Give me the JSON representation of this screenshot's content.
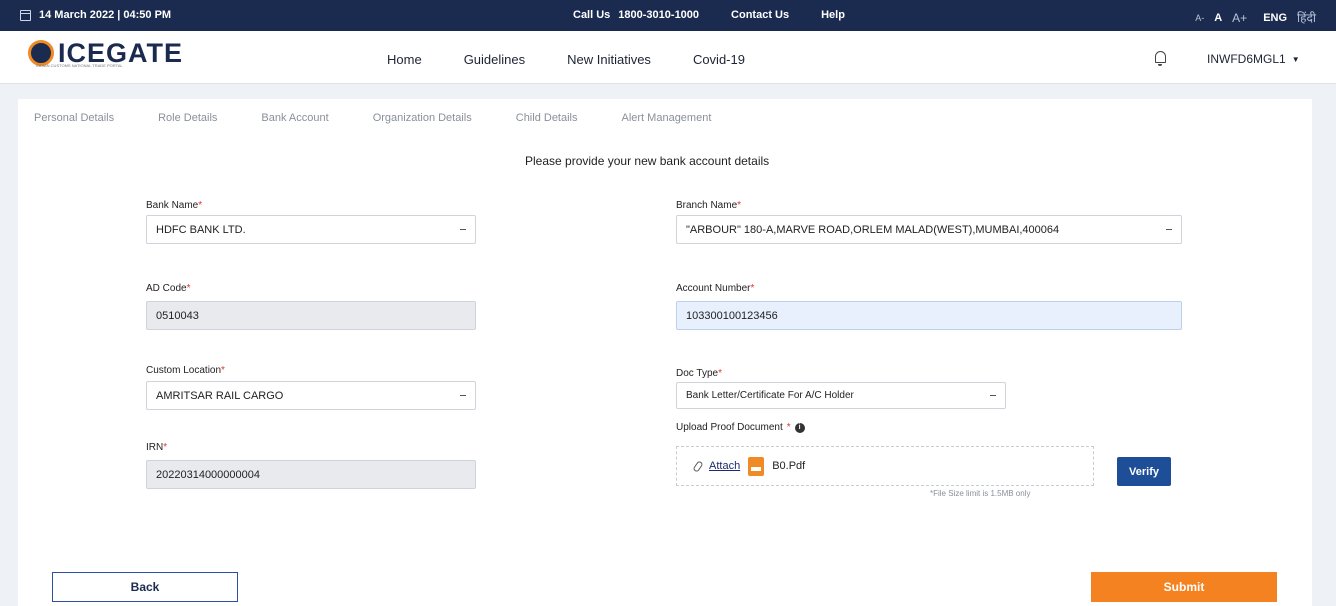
{
  "topbar": {
    "date": "14 March 2022 | 04:50 PM",
    "call_label": "Call Us",
    "phone": "1800-3010-1000",
    "contact": "Contact Us",
    "help": "Help",
    "font_small": "A-",
    "font_normal": "A",
    "font_large": "A+",
    "lang_eng": "ENG",
    "lang_hindi": "हिंदी"
  },
  "navbar": {
    "logo_text": "ICEGATE",
    "logo_sub": "INDIAN CUSTOMS NATIONAL TRADE PORTAL",
    "links": [
      "Home",
      "Guidelines",
      "New Initiatives",
      "Covid-19"
    ],
    "user": "INWFD6MGL1"
  },
  "tabs": [
    "Personal Details",
    "Role Details",
    "Bank Account",
    "Organization Details",
    "Child Details",
    "Alert Management"
  ],
  "form": {
    "heading": "Please provide your new bank account details",
    "bank_name": {
      "label": "Bank Name",
      "value": "HDFC BANK LTD."
    },
    "branch_name": {
      "label": "Branch Name",
      "value": "\"ARBOUR\" 180-A,MARVE ROAD,ORLEM MALAD(WEST),MUMBAI,400064"
    },
    "ad_code": {
      "label": "AD Code",
      "value": "0510043"
    },
    "account_number": {
      "label": "Account Number",
      "value": "103300100123456"
    },
    "custom_location": {
      "label": "Custom Location",
      "value": "AMRITSAR RAIL CARGO"
    },
    "doc_type": {
      "label": "Doc Type",
      "value": "Bank Letter/Certificate For A/C Holder"
    },
    "irn": {
      "label": "IRN",
      "value": "20220314000000004"
    },
    "upload": {
      "label": "Upload Proof Document",
      "attach": "Attach",
      "file": "B0.Pdf",
      "size_note": "*File Size limit is 1.5MB only"
    },
    "verify": "Verify",
    "required_mark": "*"
  },
  "actions": {
    "back": "Back",
    "submit": "Submit"
  },
  "colors": {
    "topbar": "#1b2b4f",
    "submit": "#f58220",
    "verify": "#1e4e97",
    "required": "#e0352b"
  }
}
